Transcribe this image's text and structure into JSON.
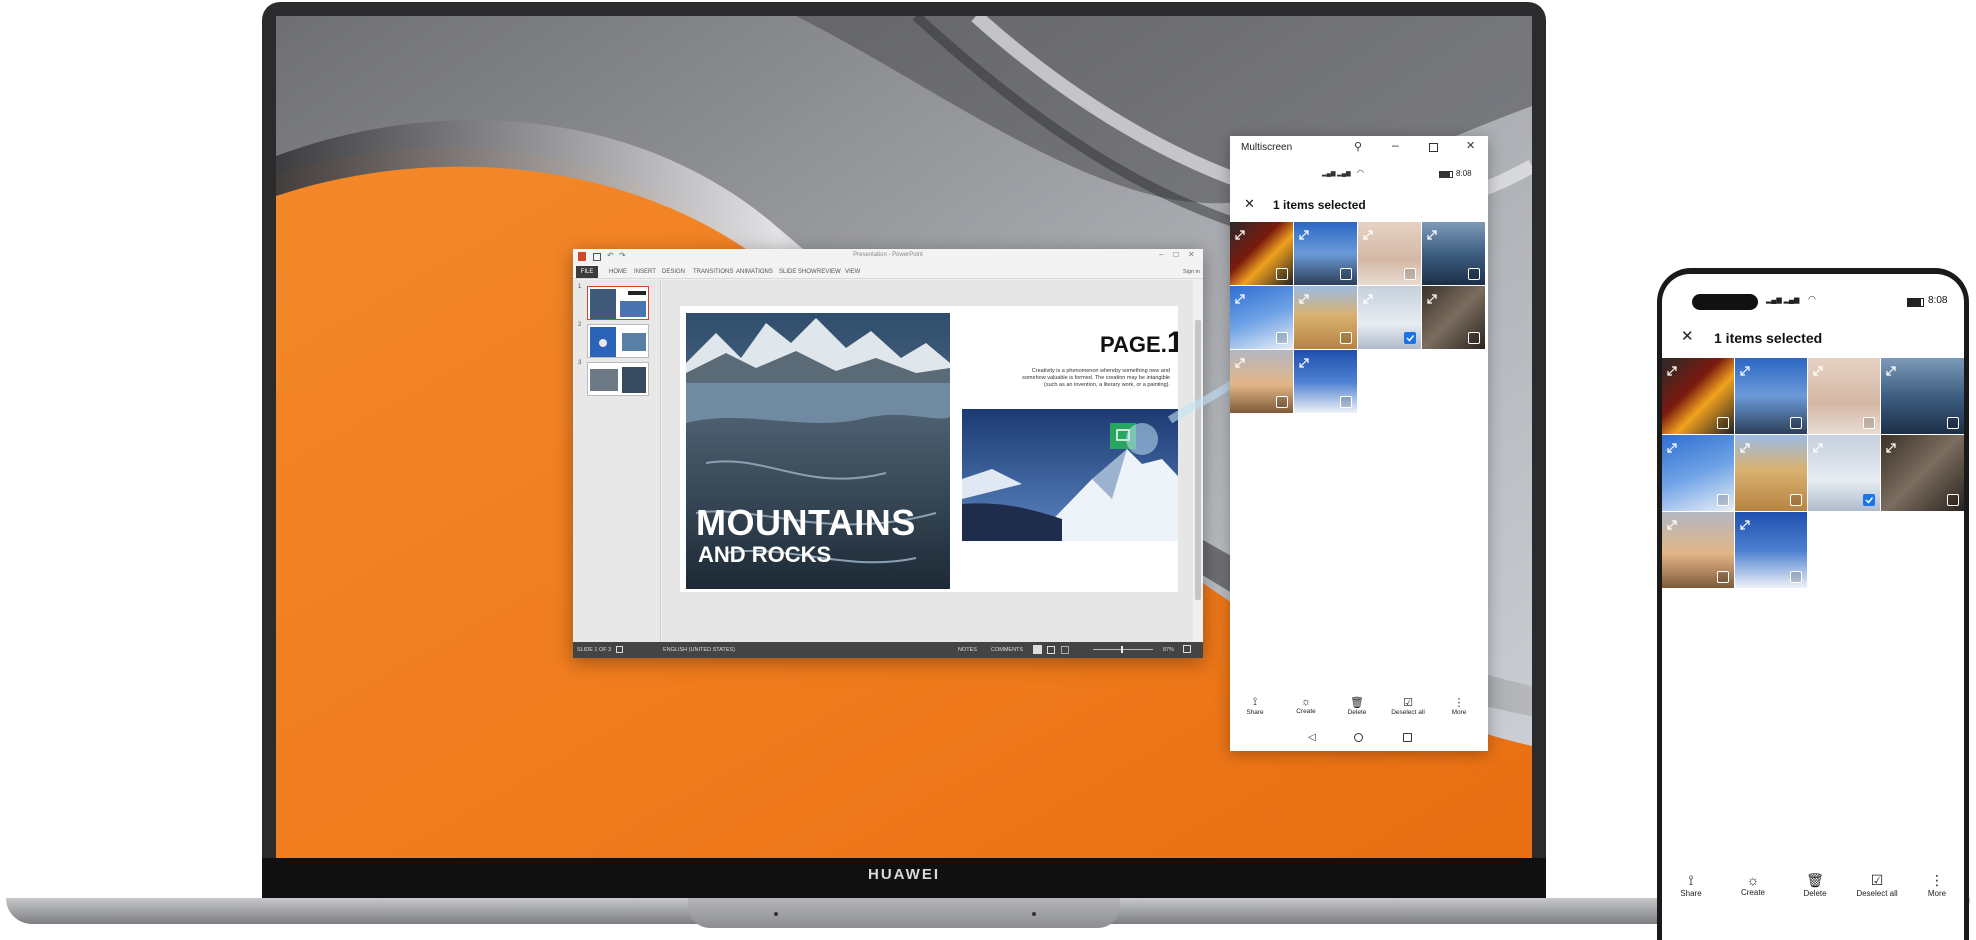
{
  "laptop": {
    "brand": "HUAWEI"
  },
  "ppt": {
    "title": "Presentation - PowerPoint",
    "signin": "Sign in",
    "tabs": [
      "FILE",
      "HOME",
      "INSERT",
      "DESIGN",
      "TRANSITIONS",
      "ANIMATIONS",
      "SLIDE SHOW",
      "REVIEW",
      "VIEW"
    ],
    "thumb_numbers": [
      "1",
      "2",
      "3"
    ],
    "slide": {
      "heading": "PAGE.",
      "heading_num": "1",
      "body": "Creativity is a phenomenon whereby something new and somehow valuable is formed. The creation may be intangible (such as an invention, a literary work, or a painting).",
      "title_big": "MOUNTAINS",
      "title_small": "AND ROCKS"
    },
    "status": {
      "slide": "SLIDE 1 OF 3",
      "language": "ENGLISH (UNITED STATES)",
      "notes": "NOTES",
      "comments": "COMMENTS",
      "zoom": "87%"
    }
  },
  "multiscreen": {
    "window_title": "Multiscreen",
    "status_time": "8:08",
    "selected_label": "1 items selected",
    "toolbar": [
      "Share",
      "Create",
      "Delete",
      "Deselect all",
      "More"
    ]
  },
  "phone": {
    "status_time": "8:08",
    "selected_label": "1 items selected",
    "toolbar": [
      "Share",
      "Create",
      "Delete",
      "Deselect all",
      "More"
    ]
  },
  "colors": {
    "accent": "#1a73e8",
    "orange": "#f07a1e"
  }
}
